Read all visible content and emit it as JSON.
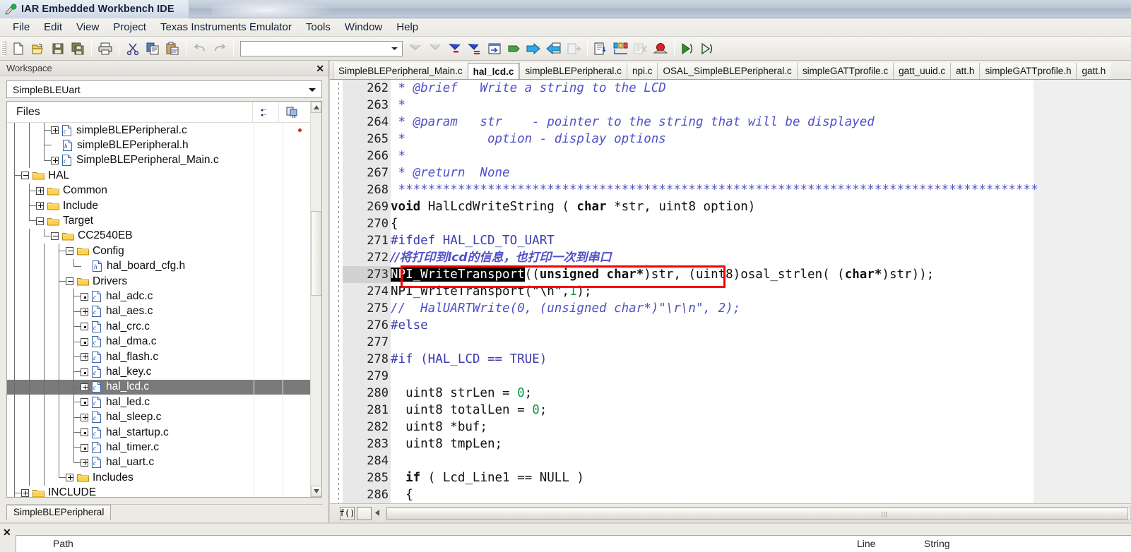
{
  "window": {
    "title": "IAR Embedded Workbench IDE",
    "app_icon": "iar-app-icon"
  },
  "menubar": {
    "items": [
      {
        "label": "File"
      },
      {
        "label": "Edit"
      },
      {
        "label": "View"
      },
      {
        "label": "Project"
      },
      {
        "label": "Texas Instruments Emulator"
      },
      {
        "label": "Tools"
      },
      {
        "label": "Window"
      },
      {
        "label": "Help"
      }
    ]
  },
  "toolbar": {
    "combo_value": "",
    "buttons": [
      {
        "icon": "new-document-icon"
      },
      {
        "icon": "open-folder-icon"
      },
      {
        "icon": "save-icon"
      },
      {
        "icon": "save-all-icon"
      },
      {
        "icon": "print-icon"
      },
      {
        "icon": "cut-scissors-icon"
      },
      {
        "icon": "copy-icon"
      },
      {
        "icon": "paste-icon"
      },
      {
        "icon": "undo-arrow-icon"
      },
      {
        "icon": "redo-arrow-icon"
      },
      {
        "icon": "find-previous-icon"
      },
      {
        "icon": "find-next-icon"
      },
      {
        "icon": "bookmark-toggle-icon"
      },
      {
        "icon": "bookmark-list-icon"
      },
      {
        "icon": "go-to-definition-icon"
      },
      {
        "icon": "compile-icon"
      },
      {
        "icon": "make-icon"
      },
      {
        "icon": "debug-build-icon"
      },
      {
        "icon": "stop-build-icon"
      },
      {
        "icon": "find-in-files-icon"
      },
      {
        "icon": "column-edit-icon"
      },
      {
        "icon": "toggle-breakpoint-disabled-icon"
      },
      {
        "icon": "breakpoint-red-icon"
      },
      {
        "icon": "download-and-debug-icon"
      },
      {
        "icon": "debug-without-download-icon"
      }
    ]
  },
  "workspace": {
    "header_title": "Workspace",
    "close_icon": "close-icon",
    "project_selector": "SimpleBLEUart",
    "dropdown_icon": "chevron-down-icon",
    "tree_header": {
      "label": "Files",
      "col2_icon": "build-status-icon",
      "col3_icon": "add-files-icon",
      "scroll_up_icon": "scroll-up-icon"
    },
    "tree": [
      {
        "label": "simpleBLEPeripheral.c",
        "depth": 3,
        "icon": "c-file-icon",
        "expander": "plus",
        "branch": "tee",
        "marker": "red-dot"
      },
      {
        "label": "simpleBLEPeripheral.h",
        "depth": 3,
        "icon": "h-file-icon",
        "expander": "none",
        "branch": "tee"
      },
      {
        "label": "SimpleBLEPeripheral_Main.c",
        "depth": 3,
        "icon": "c-file-icon",
        "expander": "plus",
        "branch": "last"
      },
      {
        "label": "HAL",
        "depth": 1,
        "icon": "folder-icon",
        "expander": "minus",
        "branch": "tee"
      },
      {
        "label": "Common",
        "depth": 2,
        "icon": "folder-icon",
        "expander": "plus",
        "branch": "tee"
      },
      {
        "label": "Include",
        "depth": 2,
        "icon": "folder-icon",
        "expander": "plus",
        "branch": "tee"
      },
      {
        "label": "Target",
        "depth": 2,
        "icon": "folder-icon",
        "expander": "minus",
        "branch": "last"
      },
      {
        "label": "CC2540EB",
        "depth": 3,
        "icon": "folder-icon",
        "expander": "minus",
        "branch": "last"
      },
      {
        "label": "Config",
        "depth": 4,
        "icon": "folder-icon",
        "expander": "minus",
        "branch": "tee"
      },
      {
        "label": "hal_board_cfg.h",
        "depth": 5,
        "icon": "h-file-icon",
        "expander": "none",
        "branch": "last"
      },
      {
        "label": "Drivers",
        "depth": 4,
        "icon": "folder-icon",
        "expander": "minus",
        "branch": "tee"
      },
      {
        "label": "hal_adc.c",
        "depth": 5,
        "icon": "c-file-icon",
        "expander": "dot",
        "branch": "tee"
      },
      {
        "label": "hal_aes.c",
        "depth": 5,
        "icon": "c-file-icon",
        "expander": "plus",
        "branch": "tee"
      },
      {
        "label": "hal_crc.c",
        "depth": 5,
        "icon": "c-file-icon",
        "expander": "dot",
        "branch": "tee"
      },
      {
        "label": "hal_dma.c",
        "depth": 5,
        "icon": "c-file-icon",
        "expander": "dot",
        "branch": "tee"
      },
      {
        "label": "hal_flash.c",
        "depth": 5,
        "icon": "c-file-icon",
        "expander": "plus",
        "branch": "tee"
      },
      {
        "label": "hal_key.c",
        "depth": 5,
        "icon": "c-file-icon",
        "expander": "dot",
        "branch": "tee"
      },
      {
        "label": "hal_lcd.c",
        "depth": 5,
        "icon": "c-file-icon",
        "expander": "plus",
        "branch": "tee",
        "selected": true
      },
      {
        "label": "hal_led.c",
        "depth": 5,
        "icon": "c-file-icon",
        "expander": "dot",
        "branch": "tee"
      },
      {
        "label": "hal_sleep.c",
        "depth": 5,
        "icon": "c-file-icon",
        "expander": "plus",
        "branch": "tee"
      },
      {
        "label": "hal_startup.c",
        "depth": 5,
        "icon": "c-file-icon",
        "expander": "dot",
        "branch": "tee"
      },
      {
        "label": "hal_timer.c",
        "depth": 5,
        "icon": "c-file-icon",
        "expander": "dot",
        "branch": "tee"
      },
      {
        "label": "hal_uart.c",
        "depth": 5,
        "icon": "c-file-icon",
        "expander": "plus",
        "branch": "last"
      },
      {
        "label": "Includes",
        "depth": 4,
        "icon": "folder-icon",
        "expander": "plus",
        "branch": "last"
      },
      {
        "label": "INCLUDE",
        "depth": 1,
        "icon": "folder-icon",
        "expander": "plus",
        "branch": "tee"
      }
    ],
    "bottom_tab": "SimpleBLEPeripheral"
  },
  "editor": {
    "tabs": [
      {
        "label": "SimpleBLEPeripheral_Main.c",
        "active": false
      },
      {
        "label": "hal_lcd.c",
        "active": true
      },
      {
        "label": "simpleBLEPeripheral.c",
        "active": false
      },
      {
        "label": "npi.c",
        "active": false
      },
      {
        "label": "OSAL_SimpleBLEPeripheral.c",
        "active": false
      },
      {
        "label": "simpleGATTprofile.c",
        "active": false
      },
      {
        "label": "gatt_uuid.c",
        "active": false
      },
      {
        "label": "att.h",
        "active": false
      },
      {
        "label": "simpleGATTprofile.h",
        "active": false
      },
      {
        "label": "gatt.h",
        "active": false
      }
    ],
    "current_line": 273,
    "highlight_box_color": "#fb0000",
    "lines": [
      {
        "n": "262",
        "text": " * @brief   Write a string to the LCD",
        "style": "comment"
      },
      {
        "n": "263",
        "text": " *",
        "style": "comment"
      },
      {
        "n": "264",
        "text": " * @param   str    - pointer to the string that will be displayed",
        "style": "comment"
      },
      {
        "n": "265",
        "text": " *           option - display options",
        "style": "comment"
      },
      {
        "n": "266",
        "text": " *",
        "style": "comment"
      },
      {
        "n": "267",
        "text": " * @return  None",
        "style": "comment"
      },
      {
        "n": "268",
        "text": " **************************************************************************************",
        "style": "comment"
      },
      {
        "n": "269",
        "text": "void HalLcdWriteString ( char *str, uint8 option)",
        "style": "code-decl"
      },
      {
        "n": "270",
        "text": "{",
        "style": "plain"
      },
      {
        "n": "271",
        "text": "#ifdef HAL_LCD_TO_UART",
        "style": "preproc"
      },
      {
        "n": "272",
        "text": "//将打印到lcd的信息，也打印一次到串口",
        "style": "cn-comment"
      },
      {
        "n": "273",
        "text": "NPI_WriteTransport((unsigned char*)str, (uint8)osal_strlen( (char*)str));",
        "style": "code-selected"
      },
      {
        "n": "274",
        "text": "NPI_WriteTransport(\"\\n\",1);",
        "style": "code-num1"
      },
      {
        "n": "275",
        "text": "//  HalUARTWrite(0, (unsigned char*)\"\\r\\n\", 2);",
        "style": "comment"
      },
      {
        "n": "276",
        "text": "#else",
        "style": "preproc"
      },
      {
        "n": "277",
        "text": "",
        "style": "plain"
      },
      {
        "n": "278",
        "text": "#if (HAL_LCD == TRUE)",
        "style": "preproc-if"
      },
      {
        "n": "279",
        "text": "",
        "style": "plain"
      },
      {
        "n": "280",
        "text": "  uint8 strLen = 0;",
        "style": "code-num0"
      },
      {
        "n": "281",
        "text": "  uint8 totalLen = 0;",
        "style": "code-num0"
      },
      {
        "n": "282",
        "text": "  uint8 *buf;",
        "style": "plain"
      },
      {
        "n": "283",
        "text": "  uint8 tmpLen;",
        "style": "plain"
      },
      {
        "n": "284",
        "text": "",
        "style": "plain"
      },
      {
        "n": "285",
        "text": "  if ( Lcd_Line1 == NULL )",
        "style": "code-if"
      },
      {
        "n": "286",
        "text": "  {",
        "style": "plain"
      }
    ],
    "hscroll": {
      "func_icon": "function-list-icon",
      "block_icon": "block-select-icon",
      "left_arrow_icon": "scroll-left-icon"
    }
  },
  "bottom_panel": {
    "close_icon": "close-icon",
    "col1": "Path",
    "col2": "Line",
    "col3": "String"
  }
}
